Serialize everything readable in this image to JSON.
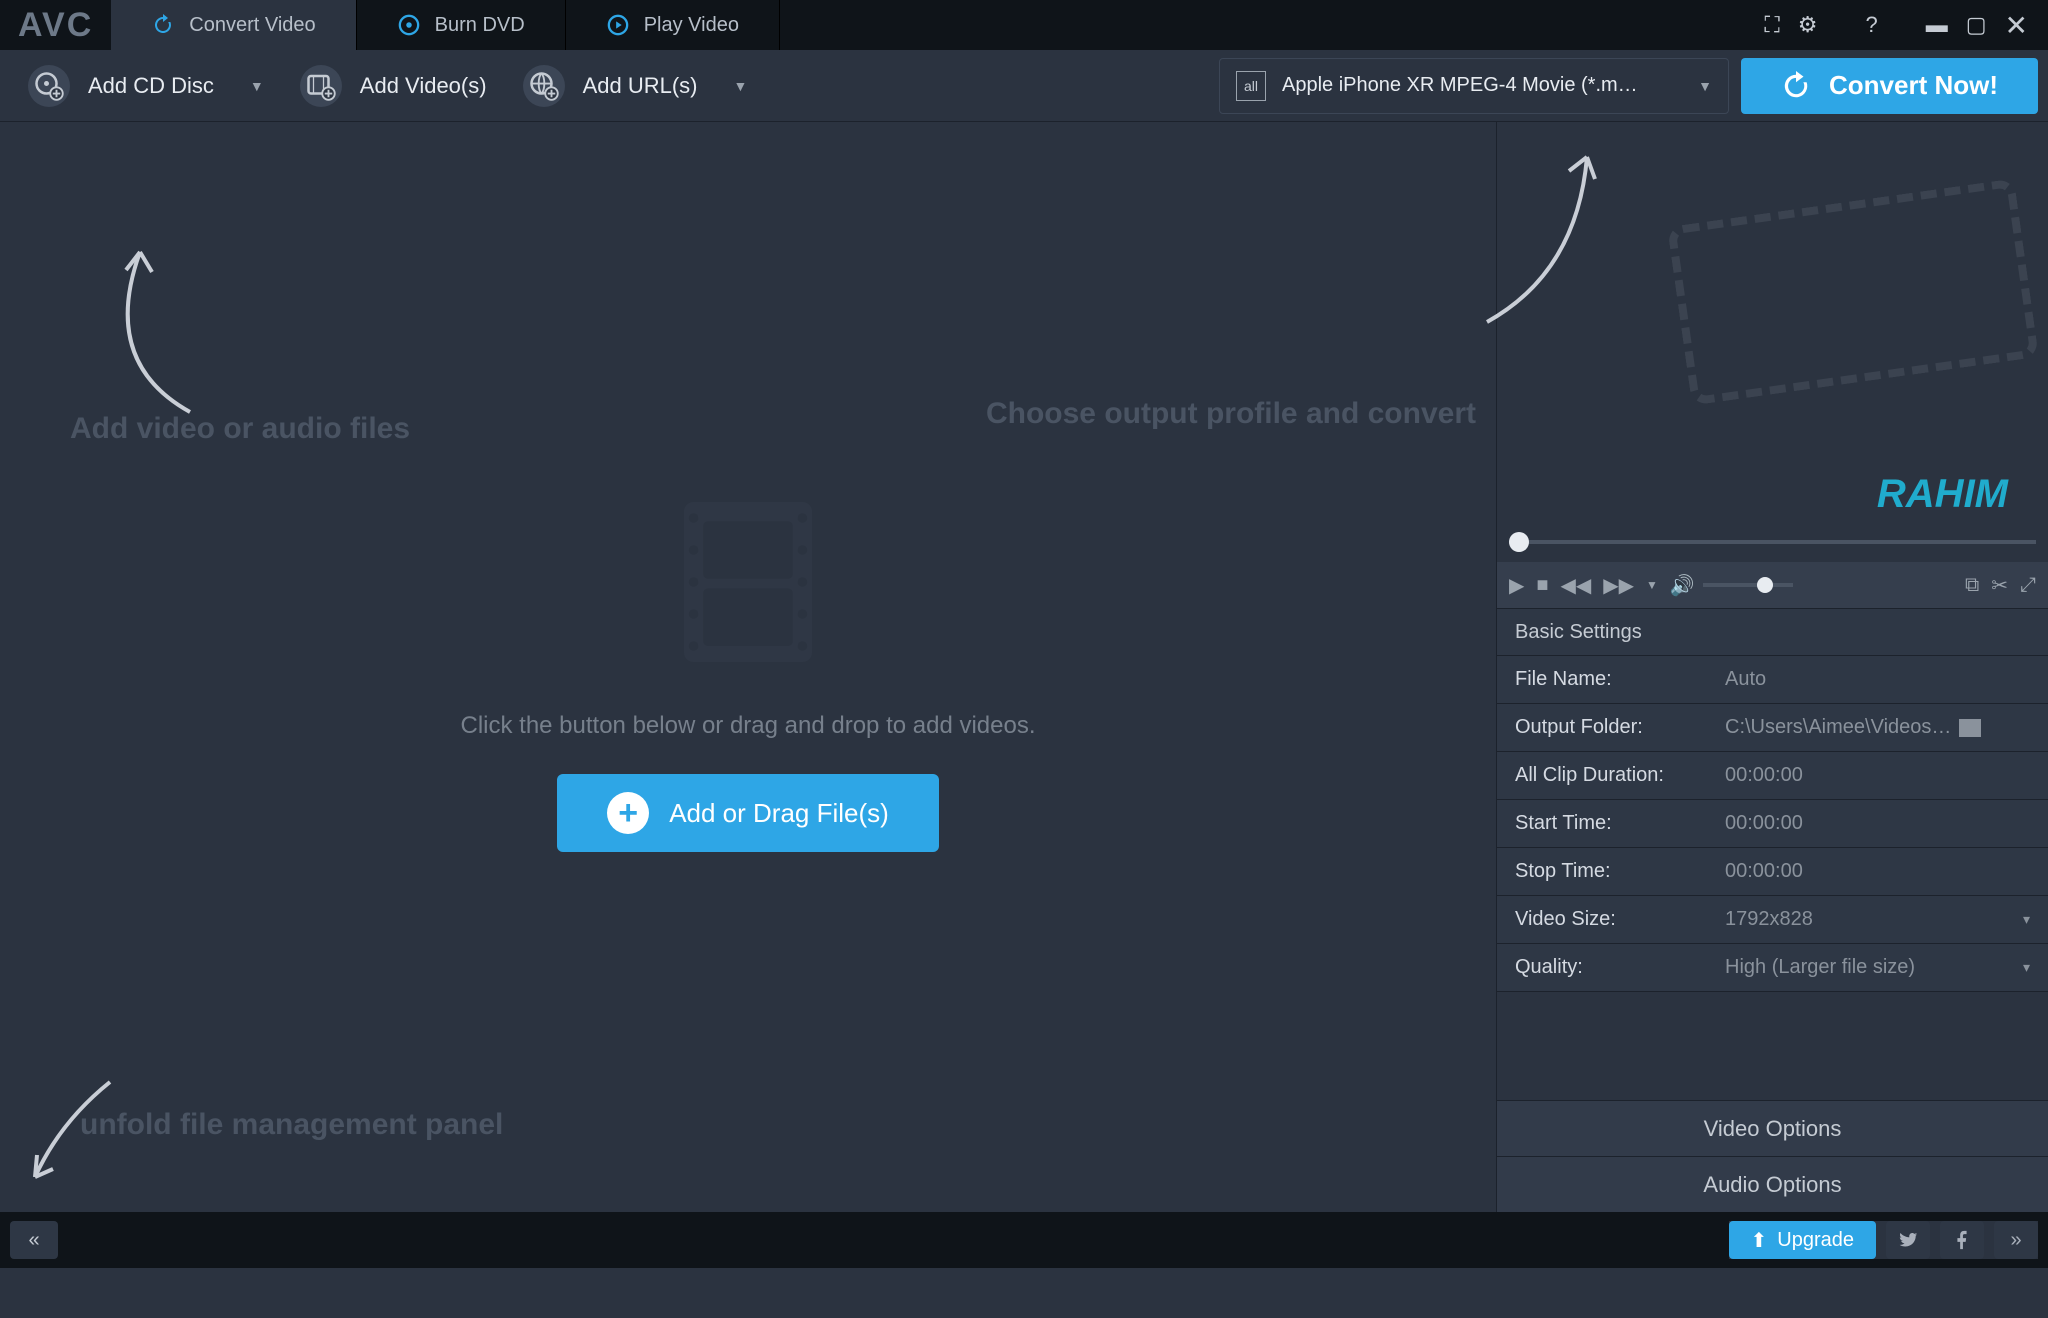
{
  "app": {
    "logo": "AVC"
  },
  "tabs": {
    "convert": "Convert Video",
    "burn": "Burn DVD",
    "play": "Play Video"
  },
  "toolbar": {
    "add_cd": "Add CD Disc",
    "add_videos": "Add Video(s)",
    "add_urls": "Add URL(s)",
    "profile_icon": "all",
    "profile": "Apple iPhone XR MPEG-4 Movie (*.m…",
    "convert": "Convert Now!"
  },
  "hints": {
    "add_files": "Add video or audio files",
    "choose_output": "Choose output profile and convert",
    "unfold": "unfold file management panel"
  },
  "drop": {
    "line": "Click the button below or drag and drop to add videos.",
    "button": "Add or Drag File(s)"
  },
  "settings": {
    "header": "Basic Settings",
    "file_name_lbl": "File Name:",
    "file_name_val": "Auto",
    "output_folder_lbl": "Output Folder:",
    "output_folder_val": "C:\\Users\\Aimee\\Videos…",
    "all_clip_lbl": "All Clip Duration:",
    "all_clip_val": "00:00:00",
    "start_lbl": "Start Time:",
    "start_val": "00:00:00",
    "stop_lbl": "Stop Time:",
    "stop_val": "00:00:00",
    "size_lbl": "Video Size:",
    "size_val": "1792x828",
    "quality_lbl": "Quality:",
    "quality_val": "High (Larger file size)"
  },
  "options": {
    "video": "Video Options",
    "audio": "Audio Options"
  },
  "footer": {
    "upgrade": "Upgrade"
  },
  "watermark": "RAHIM"
}
